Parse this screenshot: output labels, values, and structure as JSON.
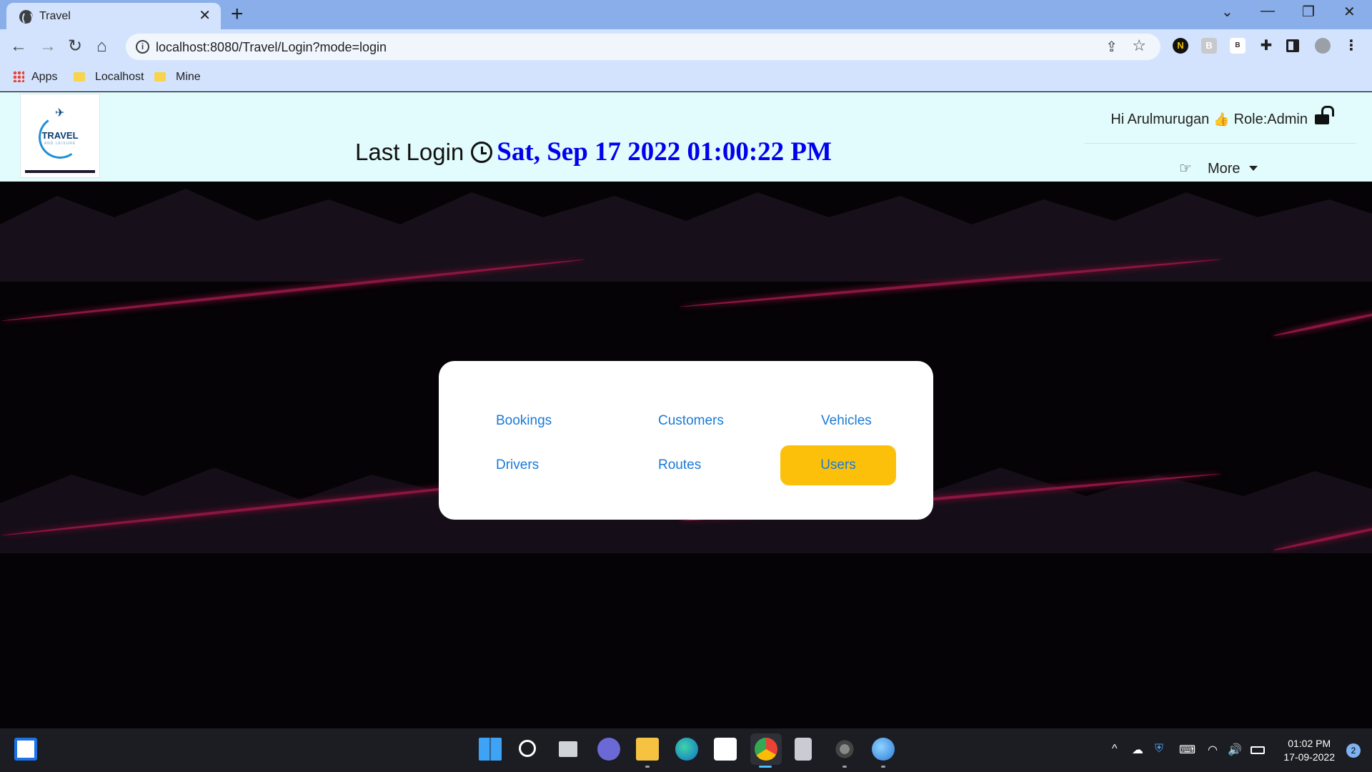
{
  "browser": {
    "tab_title": "Travel",
    "tab_close": "✕",
    "new_tab": "+",
    "url": "localhost:8080/Travel/Login?mode=login",
    "controls": {
      "dropdown": "⌄",
      "minimize": "—",
      "restore": "❐",
      "close": "✕"
    },
    "nav": {
      "back": "←",
      "forward": "→",
      "reload": "↻",
      "home": "⌂"
    },
    "bookmarks": [
      {
        "label": "Apps",
        "icon": "apps-grid-icon"
      },
      {
        "label": "Localhost",
        "icon": "folder-icon"
      },
      {
        "label": "Mine",
        "icon": "folder-icon"
      }
    ],
    "extensions": [
      {
        "label": "N",
        "bg": "#111111",
        "fg": "#f0c000"
      },
      {
        "label": "B",
        "bg": "#c7c9cc",
        "fg": "#ffffff"
      },
      {
        "label": "B",
        "bg": "#ffffff",
        "fg": "#333333"
      }
    ]
  },
  "header": {
    "logo_text": "TRAVEL",
    "logo_sub": "AND LEISURE",
    "last_login_label": "Last Login",
    "last_login_value": "Sat, Sep 17 2022 01:00:22 PM",
    "greeting": "Hi Arulmurugan",
    "role": "Role:Admin",
    "more_label": "More"
  },
  "menu": {
    "items": [
      {
        "label": "Bookings",
        "active": false
      },
      {
        "label": "Customers",
        "active": false
      },
      {
        "label": "Vehicles",
        "active": false
      },
      {
        "label": "Drivers",
        "active": false
      },
      {
        "label": "Routes",
        "active": false
      },
      {
        "label": "Users",
        "active": true
      }
    ],
    "active_color": "#fcc00b",
    "link_color": "#1a7ad6"
  },
  "taskbar": {
    "time": "01:02 PM",
    "date": "17-09-2022",
    "notifications": "2",
    "apps": [
      "windows-start-icon",
      "search-icon",
      "task-view-icon",
      "teams-chat-icon",
      "file-explorer-icon",
      "edge-icon",
      "store-icon",
      "chrome-icon",
      "notepad-icon",
      "settings-icon",
      "globe-app-icon"
    ]
  }
}
